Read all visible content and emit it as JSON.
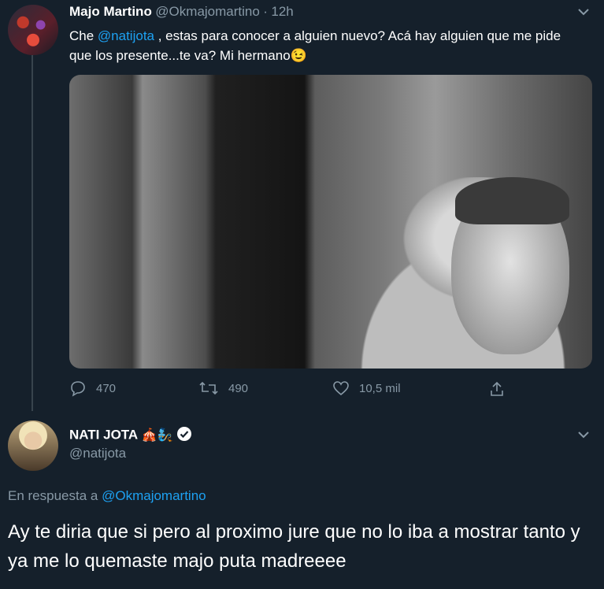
{
  "tweet": {
    "author_name": "Majo Martino",
    "author_handle": "@Okmajomartino",
    "separator": "·",
    "time": "12h",
    "text_before_mention": "Che ",
    "mention": "@natijota",
    "text_after_mention": " , estas para conocer a alguien nuevo? Acá hay alguien que me pide que los presente...te va? Mi hermano",
    "emoji": "😉",
    "replies_count": "470",
    "retweets_count": "490",
    "likes_count": "10,5 mil"
  },
  "reply": {
    "author_name": "NATI JOTA",
    "author_emojis": "🎪🧞",
    "author_handle": "@natijota",
    "in_reply_prefix": "En respuesta a",
    "in_reply_handle": "@Okmajomartino",
    "text": "Ay te diria que si pero al proximo jure que no lo iba a mostrar tanto y ya me lo quemaste majo puta madreeee"
  },
  "colors": {
    "background": "#15202b",
    "accent": "#1da1f2",
    "secondary_text": "#8899a6"
  },
  "icons": [
    "chevron-down-icon",
    "reply-icon",
    "retweet-icon",
    "like-icon",
    "share-icon",
    "verified-icon"
  ]
}
